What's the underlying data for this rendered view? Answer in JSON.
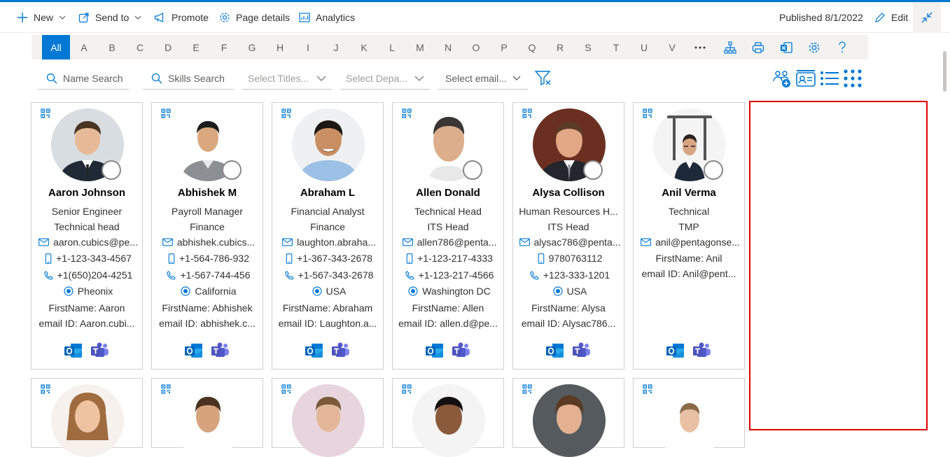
{
  "commandbar": {
    "new_label": "New",
    "send_to_label": "Send to",
    "promote_label": "Promote",
    "page_details_label": "Page details",
    "analytics_label": "Analytics",
    "published_label": "Published 8/1/2022",
    "edit_label": "Edit"
  },
  "alphabet": [
    "All",
    "A",
    "B",
    "C",
    "D",
    "E",
    "F",
    "G",
    "H",
    "I",
    "J",
    "K",
    "L",
    "M",
    "N",
    "O",
    "P",
    "Q",
    "R",
    "S",
    "T",
    "U",
    "V"
  ],
  "toolbar_icons": [
    "more-icon",
    "org-chart-icon",
    "print-icon",
    "excel-icon",
    "settings-icon",
    "help-icon"
  ],
  "filters": {
    "name_search": "Name Search",
    "skills_search": "Skills Search",
    "titles": "Select Titles...",
    "departments": "Select Depa...",
    "email": "Select email..."
  },
  "view_icons": [
    "add-people-icon",
    "contact-card-icon",
    "list-view-icon",
    "grid-view-icon"
  ],
  "people": [
    {
      "name": "Aaron Johnson",
      "title": "Senior Engineer",
      "department": "Technical head",
      "email": "aaron.cubics@pe...",
      "mobile": "+1-123-343-4567",
      "phone": "+1(650)204-4251",
      "location": "Pheonix",
      "firstname": "FirstName: Aaron",
      "emailid": "email ID: Aaron.cubi..."
    },
    {
      "name": "Abhishek M",
      "title": "Payroll Manager",
      "department": "Finance",
      "email": "abhishek.cubics...",
      "mobile": "+1-564-786-932",
      "phone": "+1-567-744-456",
      "location": "California",
      "firstname": "FirstName: Abhishek",
      "emailid": "email ID: abhishek.c..."
    },
    {
      "name": "Abraham L",
      "title": "Financial Analyst",
      "department": "Finance",
      "email": "laughton.abraha...",
      "mobile": "+1-367-343-2678",
      "phone": "+1-567-343-2678",
      "location": "USA",
      "firstname": "FirstName: Abraham",
      "emailid": "email ID: Laughton.a..."
    },
    {
      "name": "Allen Donald",
      "title": "Technical Head",
      "department": "ITS Head",
      "email": "allen786@penta...",
      "mobile": "+1-123-217-4333",
      "phone": "+1-123-217-4566",
      "location": "Washington DC",
      "firstname": "FirstName: Allen",
      "emailid": "email ID: allen.d@pe..."
    },
    {
      "name": "Alysa Collison",
      "title": "Human Resources H...",
      "department": "ITS Head",
      "email": "alysac786@penta...",
      "mobile": "9780763112",
      "phone": "+123-333-1201",
      "location": "USA",
      "firstname": "FirstName: Alysa",
      "emailid": "email ID: Alysac786..."
    },
    {
      "name": "Anil Verma",
      "title": "Technical",
      "department": "TMP",
      "email": "anil@pentagonse...",
      "firstname": "FirstName: Anil",
      "emailid": "email ID: Anil@pent..."
    }
  ],
  "colors": {
    "accent": "#0078d4",
    "highlight_box": "#e00000",
    "outlook": "#0364b8",
    "teams": "#5059c9"
  }
}
